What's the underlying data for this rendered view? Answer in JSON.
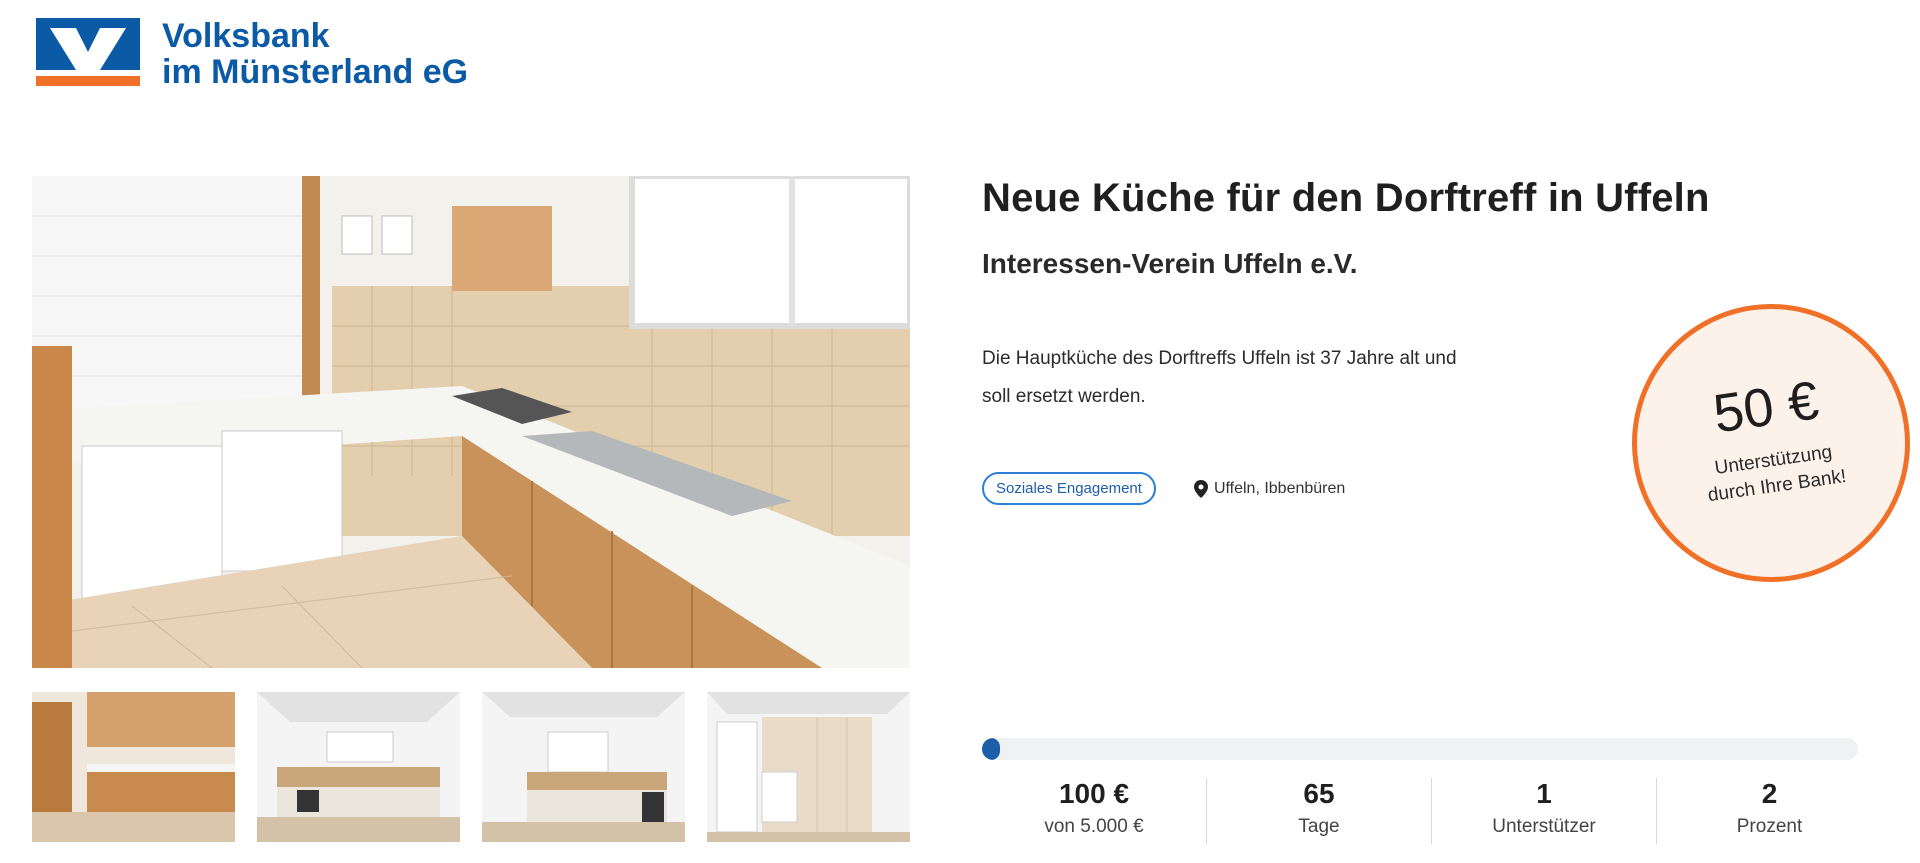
{
  "header": {
    "bank_name_line1": "Volksbank",
    "bank_name_line2": "im Münsterland eG",
    "logo_icon": "volksbank-logo-icon",
    "brand_blue": "#0a5aa6",
    "brand_orange": "#f07028"
  },
  "gallery": {
    "main_image": "kitchen-photo",
    "thumbnails": [
      "kitchen-photo-thumb",
      "kitchen-plan-render-1",
      "kitchen-plan-render-2",
      "kitchen-plan-render-3"
    ]
  },
  "project": {
    "title": "Neue Küche für den Dorftreff in Uffeln",
    "organization": "Interessen-Verein Uffeln e.V.",
    "description_line1": "Die Hauptküche des Dorftreffs Uffeln ist 37 Jahre alt und",
    "description_line2": "soll ersetzt werden.",
    "tag": "Soziales Engagement",
    "location_icon": "map-pin-icon",
    "location": "Uffeln, Ibbenbüren"
  },
  "badge": {
    "amount": "50 €",
    "label_line1": "Unterstützung",
    "label_line2": "durch Ihre Bank!"
  },
  "progress": {
    "percent": 2
  },
  "stats": [
    {
      "value": "100 €",
      "label": "von 5.000 €"
    },
    {
      "value": "65",
      "label": "Tage"
    },
    {
      "value": "1",
      "label": "Unterstützer"
    },
    {
      "value": "2",
      "label": "Prozent"
    }
  ]
}
